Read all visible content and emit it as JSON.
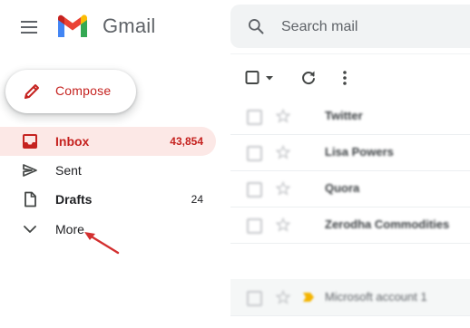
{
  "header": {
    "app_name": "Gmail",
    "menu_icon": "hamburger-menu-icon",
    "logo_icon": "gmail-logo-icon"
  },
  "search": {
    "placeholder": "Search mail",
    "icon": "search-icon"
  },
  "compose": {
    "label": "Compose",
    "icon": "pencil-icon"
  },
  "nav": {
    "items": [
      {
        "label": "Inbox",
        "count": "43,854",
        "icon": "inbox-icon",
        "active": true
      },
      {
        "label": "Sent",
        "count": "",
        "icon": "send-icon",
        "active": false
      },
      {
        "label": "Drafts",
        "count": "24",
        "icon": "draft-icon",
        "active": false
      },
      {
        "label": "More",
        "count": "",
        "icon": "chevron-down-icon",
        "active": false
      }
    ]
  },
  "toolbar": {
    "select_icon": "checkbox-dropdown-icon",
    "refresh_icon": "refresh-icon",
    "more_icon": "more-vert-icon"
  },
  "mails": [
    {
      "sender": "Twitter"
    },
    {
      "sender": "Lisa Powers"
    },
    {
      "sender": "Quora"
    },
    {
      "sender": "Zerodha Commodities"
    },
    {
      "sender": "Microsoft account 1"
    }
  ],
  "colors": {
    "accent": "#c5221f",
    "active_bg": "#fce8e6",
    "search_bg": "#f1f3f4",
    "annotation_arrow": "#d32f2f"
  }
}
